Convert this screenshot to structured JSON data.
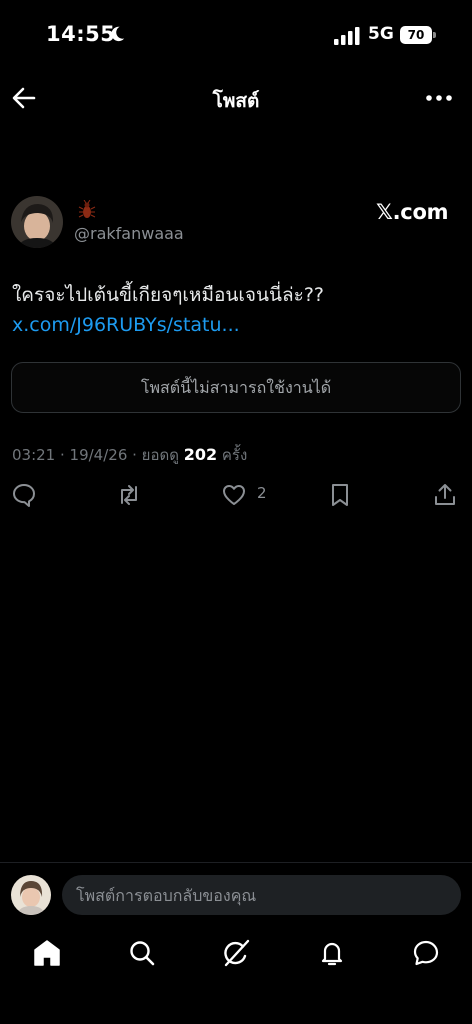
{
  "status_bar": {
    "time": "14:55",
    "network": "5G",
    "battery": "70"
  },
  "nav": {
    "title": "โพสต์"
  },
  "post": {
    "handle": "@rakfanwaaa",
    "source": "𝕏.com",
    "text": "ใครจะไปเต้นขี้เกียจๆเหมือนเจนนี่ล่ะ?? ",
    "link": "x.com/J96RUBYs/statu...",
    "unavailable_notice": "โพสต์นี้ไม่สามารถใช้งานได้",
    "timestamp": "03:21 · 19/4/26 · ยอดดู ",
    "views": "202",
    "views_suffix": " ครั้ง",
    "likes": "2"
  },
  "reply": {
    "placeholder": "โพสต์การตอบกลับของคุณ"
  },
  "icons": {
    "back": "arrow-left-icon",
    "more": "more-horizontal-icon",
    "reply": "reply-icon",
    "repost": "repost-icon",
    "like": "heart-icon",
    "bookmark": "bookmark-icon",
    "share": "share-icon",
    "home": "home-icon",
    "search": "search-icon",
    "grok": "grok-icon",
    "notifications": "bell-icon",
    "messages": "message-icon"
  },
  "colors": {
    "link": "#1d9bf0",
    "background": "#000000",
    "muted": "#71767b"
  }
}
